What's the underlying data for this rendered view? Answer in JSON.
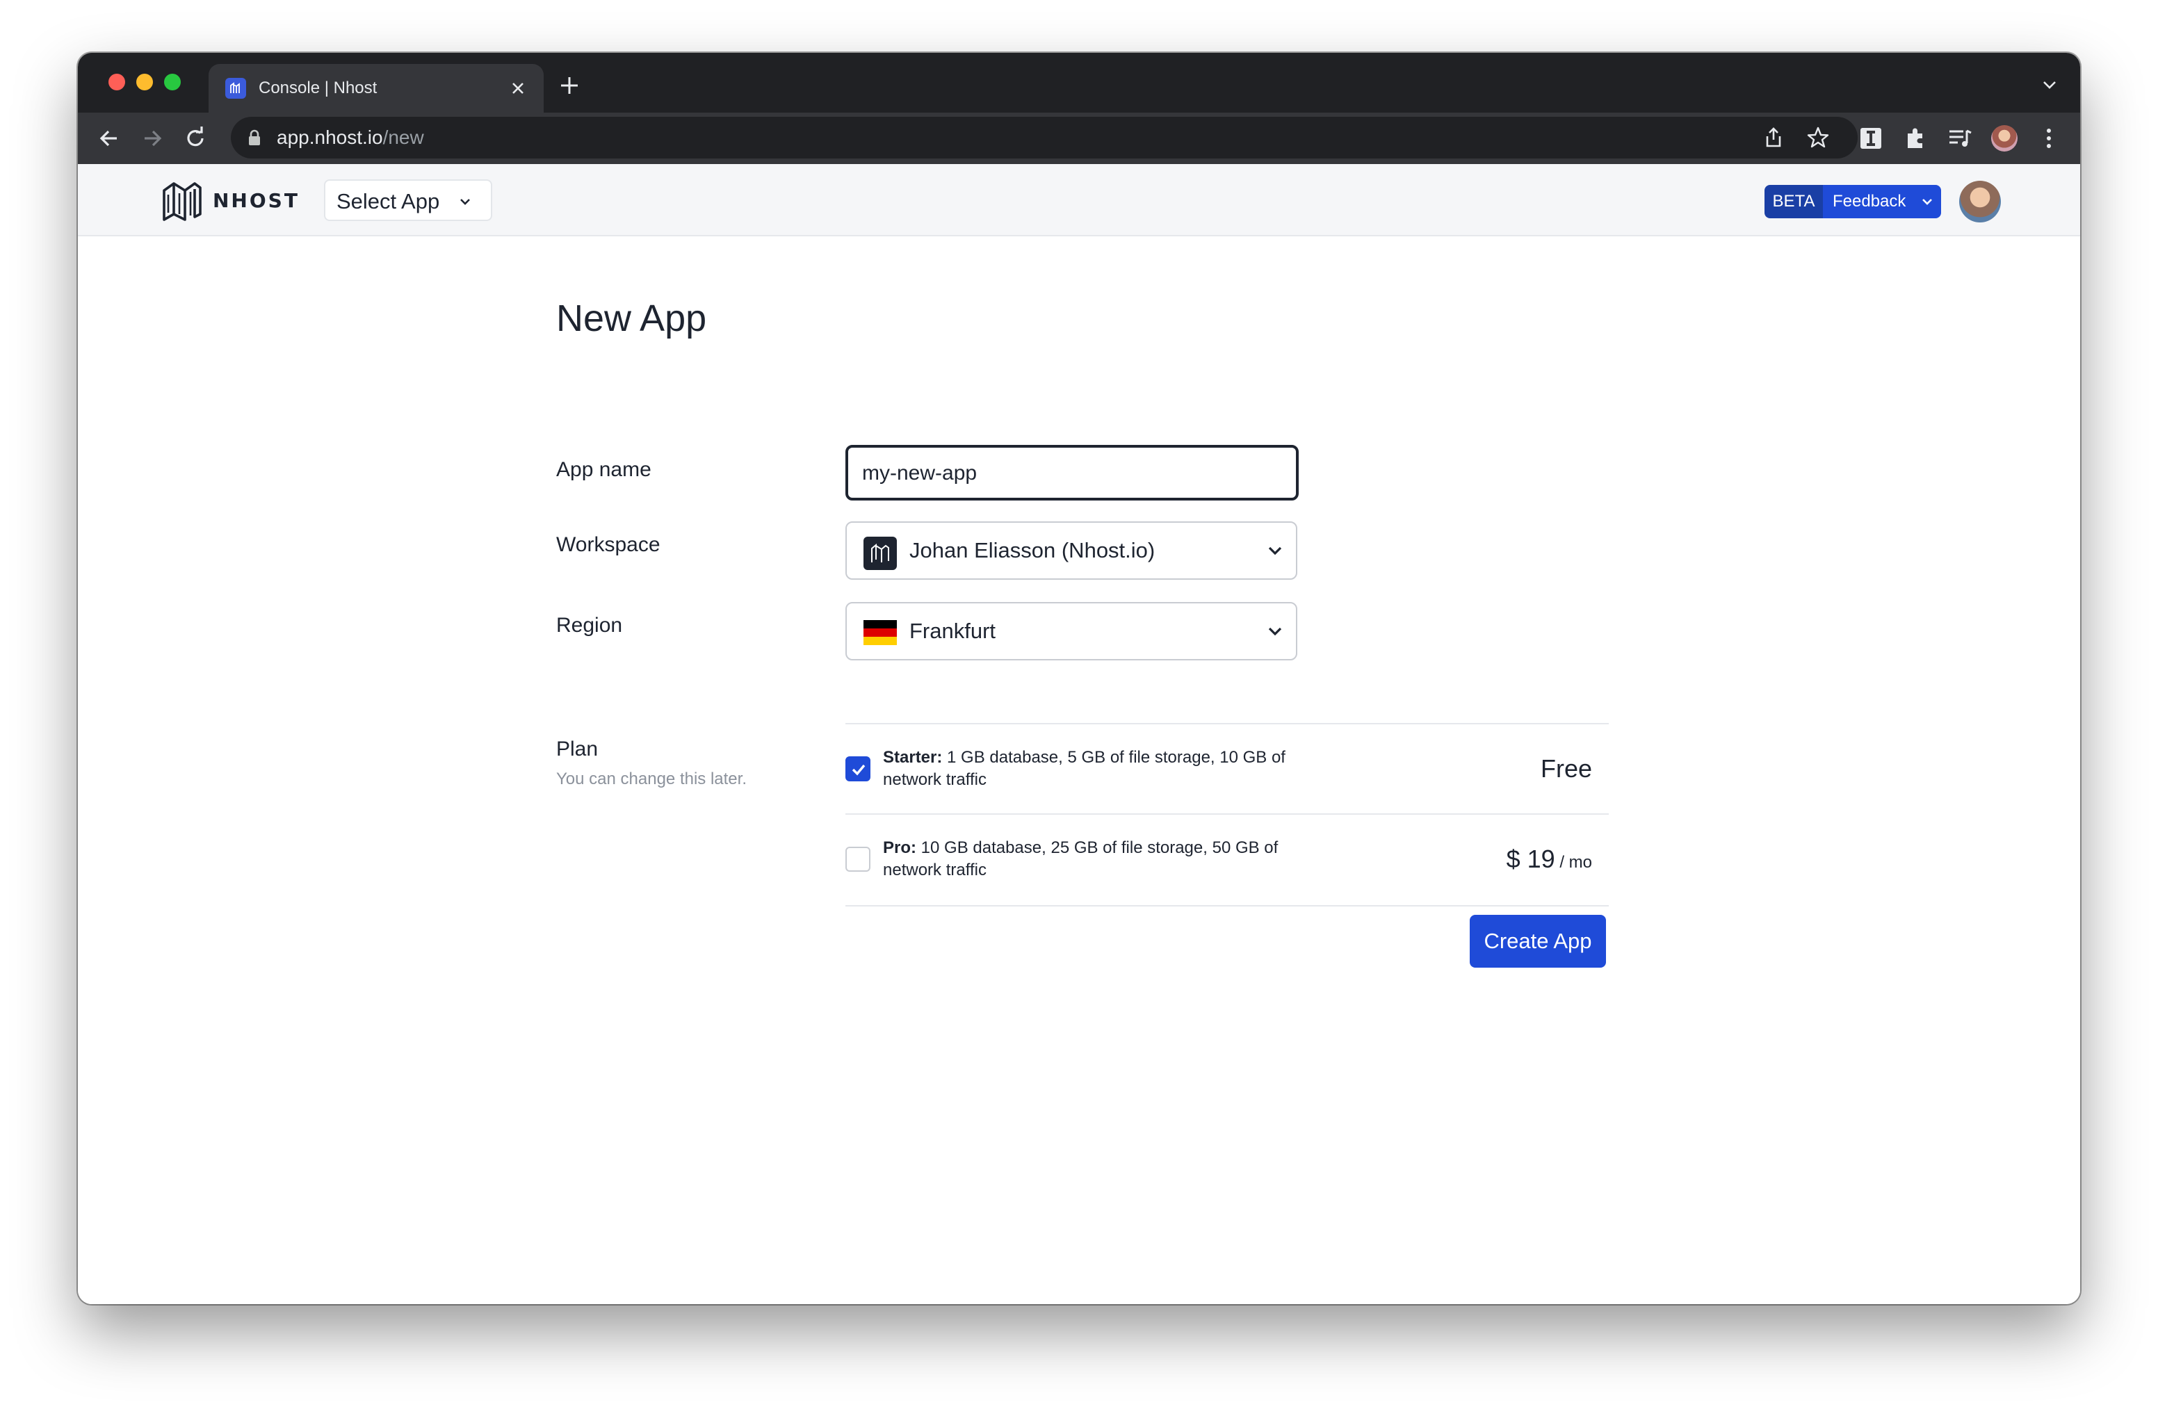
{
  "browser": {
    "tab_title": "Console | Nhost",
    "url_host": "app.nhost.io",
    "url_path": "/new"
  },
  "header": {
    "logo_text": "NHOST",
    "select_app_label": "Select App",
    "beta_label": "BETA",
    "feedback_label": "Feedback"
  },
  "form": {
    "title": "New App",
    "app_name": {
      "label": "App name",
      "value": "my-new-app"
    },
    "workspace": {
      "label": "Workspace",
      "value": "Johan Eliasson (Nhost.io)"
    },
    "region": {
      "label": "Region",
      "value": "Frankfurt"
    },
    "plan": {
      "label": "Plan",
      "sublabel": "You can change this later.",
      "options": [
        {
          "name": "Starter:",
          "description": " 1 GB database, 5 GB of file storage, 10 GB of network traffic",
          "price": "Free",
          "unit": "",
          "checked": true
        },
        {
          "name": "Pro:",
          "description": " 10 GB database, 25 GB of file storage, 50 GB of network traffic",
          "price": "$ 19",
          "unit": " / mo",
          "checked": false
        }
      ]
    },
    "create_label": "Create App"
  },
  "colors": {
    "accent": "#1f4bd8",
    "text": "#1e2430",
    "muted": "#8b919b"
  }
}
